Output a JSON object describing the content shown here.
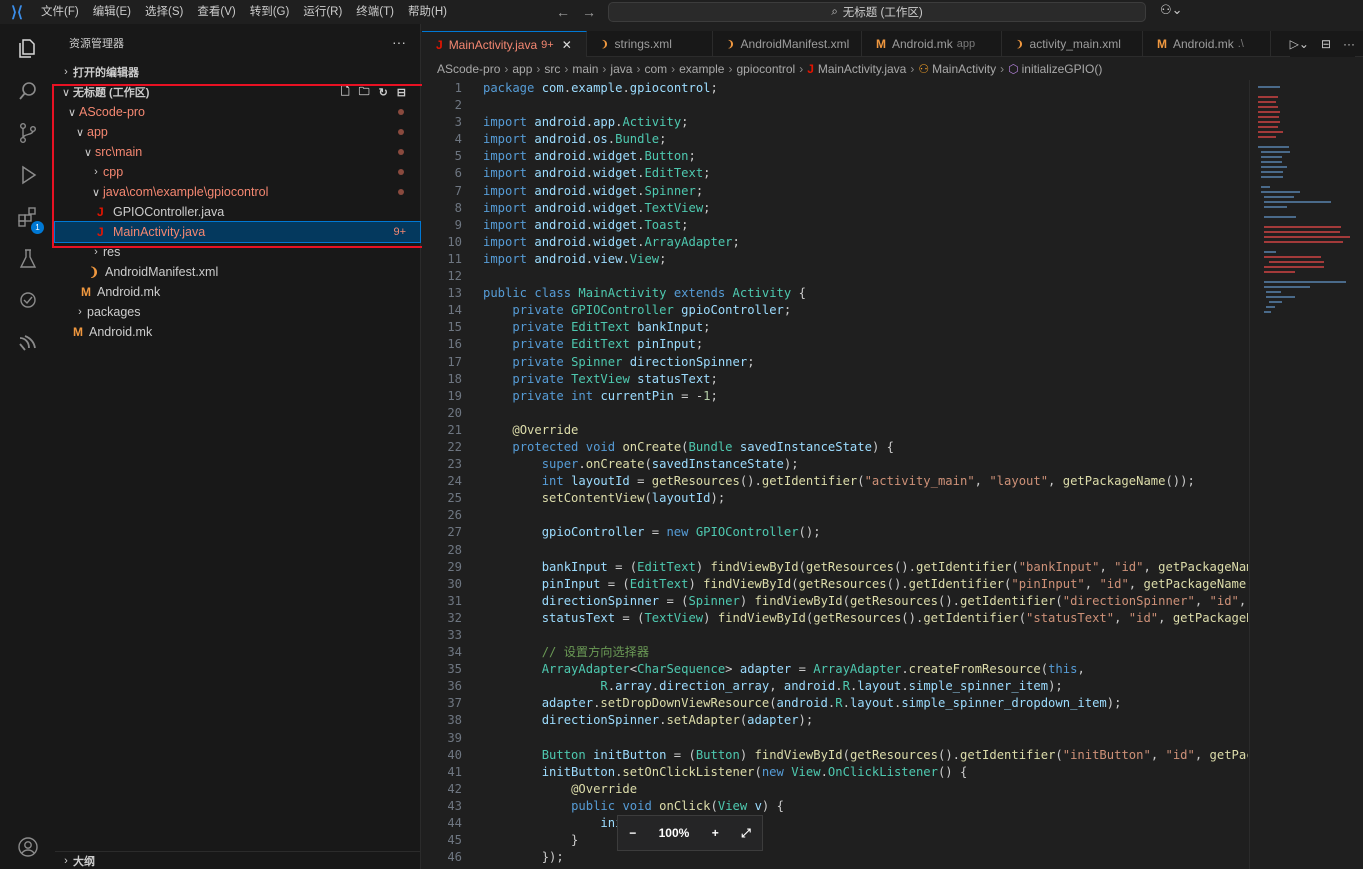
{
  "menu": [
    "文件(F)",
    "编辑(E)",
    "选择(S)",
    "查看(V)",
    "转到(G)",
    "运行(R)",
    "终端(T)",
    "帮助(H)"
  ],
  "command_center": "无标题 (工作区)",
  "sidebar": {
    "title": "资源管理器",
    "open_editors": "打开的编辑器",
    "workspace": "无标题 (工作区)",
    "outline": "大纲",
    "tree": [
      {
        "label": "AScode-pro",
        "indent": 1,
        "chev": "∨",
        "icon": "",
        "red": true,
        "dot": true
      },
      {
        "label": "app",
        "indent": 2,
        "chev": "∨",
        "icon": "",
        "red": true,
        "dot": true
      },
      {
        "label": "src\\main",
        "indent": 3,
        "chev": "∨",
        "icon": "",
        "red": true,
        "dot": true
      },
      {
        "label": "cpp",
        "indent": 4,
        "chev": ">",
        "icon": "",
        "red": true,
        "dot": true
      },
      {
        "label": "java\\com\\example\\gpiocontrol",
        "indent": 4,
        "chev": "∨",
        "icon": "",
        "red": true,
        "dot": true
      },
      {
        "label": "GPIOController.java",
        "indent": 5,
        "chev": "",
        "icon": "J",
        "red": false,
        "dot": false
      },
      {
        "label": "MainActivity.java",
        "indent": 5,
        "chev": "",
        "icon": "J",
        "red": true,
        "dot": false,
        "selected": true,
        "count": "9+"
      },
      {
        "label": "res",
        "indent": 4,
        "chev": ">",
        "icon": "",
        "red": false,
        "dot": false
      },
      {
        "label": "AndroidManifest.xml",
        "indent": 4,
        "chev": "",
        "icon": "xml",
        "red": false,
        "dot": false
      },
      {
        "label": "Android.mk",
        "indent": 3,
        "chev": "",
        "icon": "M",
        "red": false,
        "dot": false
      },
      {
        "label": "packages",
        "indent": 2,
        "chev": ">",
        "icon": "",
        "red": false,
        "dot": false
      },
      {
        "label": "Android.mk",
        "indent": 2,
        "chev": "",
        "icon": "M",
        "red": false,
        "dot": false
      }
    ]
  },
  "tabs": [
    {
      "label": "MainActivity.java",
      "extra": "9+",
      "icon": "J",
      "active": true
    },
    {
      "label": "strings.xml",
      "extra": "",
      "icon": "xml",
      "active": false
    },
    {
      "label": "AndroidManifest.xml",
      "extra": "",
      "icon": "xml",
      "active": false
    },
    {
      "label": "Android.mk",
      "extra": "app",
      "icon": "M",
      "active": false
    },
    {
      "label": "activity_main.xml",
      "extra": "",
      "icon": "xml",
      "active": false
    },
    {
      "label": "Android.mk",
      "extra": ".\\",
      "icon": "M",
      "active": false
    }
  ],
  "breadcrumb": [
    "AScode-pro",
    "app",
    "src",
    "main",
    "java",
    "com",
    "example",
    "gpiocontrol",
    "MainActivity.java",
    "MainActivity",
    "initializeGPIO()"
  ],
  "code": [
    "package com.example.gpiocontrol;",
    "",
    "import android.app.Activity;",
    "import android.os.Bundle;",
    "import android.widget.Button;",
    "import android.widget.EditText;",
    "import android.widget.Spinner;",
    "import android.widget.TextView;",
    "import android.widget.Toast;",
    "import android.widget.ArrayAdapter;",
    "import android.view.View;",
    "",
    "public class MainActivity extends Activity {",
    "    private GPIOController gpioController;",
    "    private EditText bankInput;",
    "    private EditText pinInput;",
    "    private Spinner directionSpinner;",
    "    private TextView statusText;",
    "    private int currentPin = -1;",
    "",
    "    @Override",
    "    protected void onCreate(Bundle savedInstanceState) {",
    "        super.onCreate(savedInstanceState);",
    "        int layoutId = getResources().getIdentifier(\"activity_main\", \"layout\", getPackageName());",
    "        setContentView(layoutId);",
    "",
    "        gpioController = new GPIOController();",
    "",
    "        bankInput = (EditText) findViewById(getResources().getIdentifier(\"bankInput\", \"id\", getPackageName()));",
    "        pinInput = (EditText) findViewById(getResources().getIdentifier(\"pinInput\", \"id\", getPackageName()));",
    "        directionSpinner = (Spinner) findViewById(getResources().getIdentifier(\"directionSpinner\", \"id\", getPackageName()));",
    "        statusText = (TextView) findViewById(getResources().getIdentifier(\"statusText\", \"id\", getPackageName()));",
    "",
    "        // 设置方向选择器",
    "        ArrayAdapter<CharSequence> adapter = ArrayAdapter.createFromResource(this,",
    "                R.array.direction_array, android.R.layout.simple_spinner_item);",
    "        adapter.setDropDownViewResource(android.R.layout.simple_spinner_dropdown_item);",
    "        directionSpinner.setAdapter(adapter);",
    "",
    "        Button initButton = (Button) findViewById(getResources().getIdentifier(\"initButton\", \"id\", getPackageName()));",
    "        initButton.setOnClickListener(new View.OnClickListener() {",
    "            @Override",
    "            public void onClick(View v) {",
    "                ini",
    "            }",
    "        });"
  ],
  "zoom": {
    "minus": "−",
    "level": "100%",
    "plus": "+"
  },
  "colors": {
    "accent": "#0078d4",
    "error": "#f48771",
    "highlight_box": "#e81123"
  }
}
